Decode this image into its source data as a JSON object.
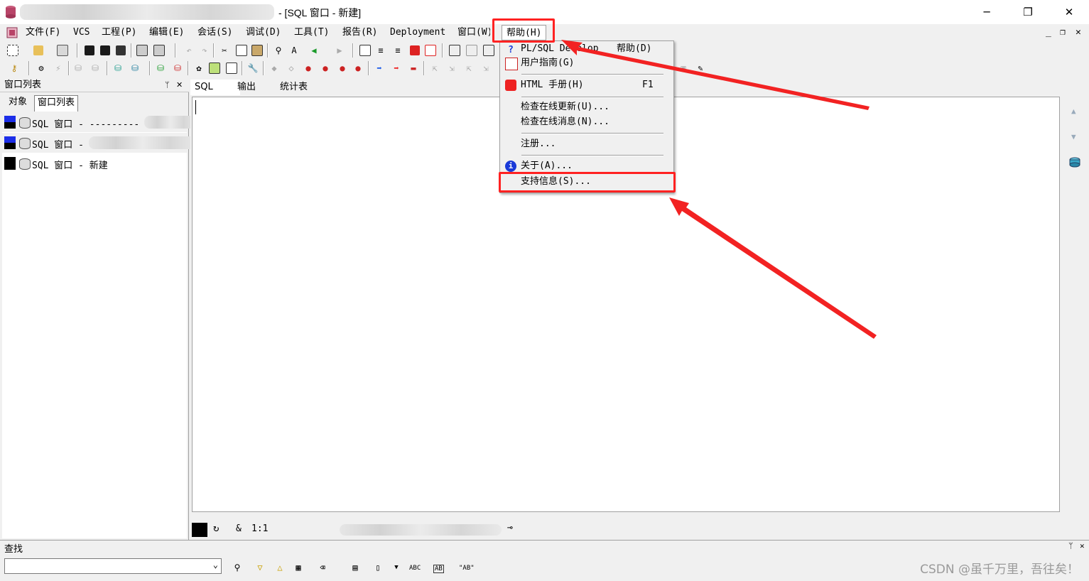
{
  "window": {
    "title": "- [SQL 窗口 - 新建]",
    "minimize": "─",
    "maximize": "❐",
    "close": "✕"
  },
  "menubar": {
    "items": [
      "文件(F)",
      "VCS",
      "工程(P)",
      "编辑(E)",
      "会话(S)",
      "调试(D)",
      "工具(T)",
      "报告(R)",
      "Deployment",
      "窗口(W)",
      "帮助(H)"
    ],
    "mdi_controls": [
      "_",
      "❐",
      "✕"
    ]
  },
  "left_panel": {
    "header": "窗口列表",
    "pin": "ᛘ",
    "close": "✕",
    "tabs": [
      "对象",
      "窗口列表"
    ],
    "rows": [
      {
        "label": "SQL 窗口 - ---------"
      },
      {
        "label": "SQL 窗口 -"
      },
      {
        "label": "SQL 窗口 - 新建"
      }
    ]
  },
  "editor": {
    "tabs": [
      "SQL",
      "输出",
      "统计表"
    ]
  },
  "status": {
    "amp": "&",
    "position": "1:1"
  },
  "help_menu": {
    "items": [
      {
        "label": "PL/SQL Develop",
        "suffix": "帮助(D)",
        "icon": "question-icon"
      },
      {
        "label": "用户指南(G)",
        "icon": "pdf-icon"
      },
      {
        "label": "HTML 手册(H)",
        "key": "F1",
        "icon": "oracle-icon"
      },
      {
        "label": "检查在线更新(U)..."
      },
      {
        "label": "检查在线消息(N)..."
      },
      {
        "label": "注册..."
      },
      {
        "label": "关于(A)...",
        "icon": "info-icon"
      },
      {
        "label": "支持信息(S)..."
      }
    ]
  },
  "find": {
    "label": "查找",
    "input_value": "",
    "tools": [
      "ABC",
      "AB",
      "\"AB\""
    ]
  },
  "watermark": "CSDN @虽千万里，吾往矣！",
  "colors": {
    "highlight_red": "#f22222",
    "arrow_red": "#f22222"
  }
}
